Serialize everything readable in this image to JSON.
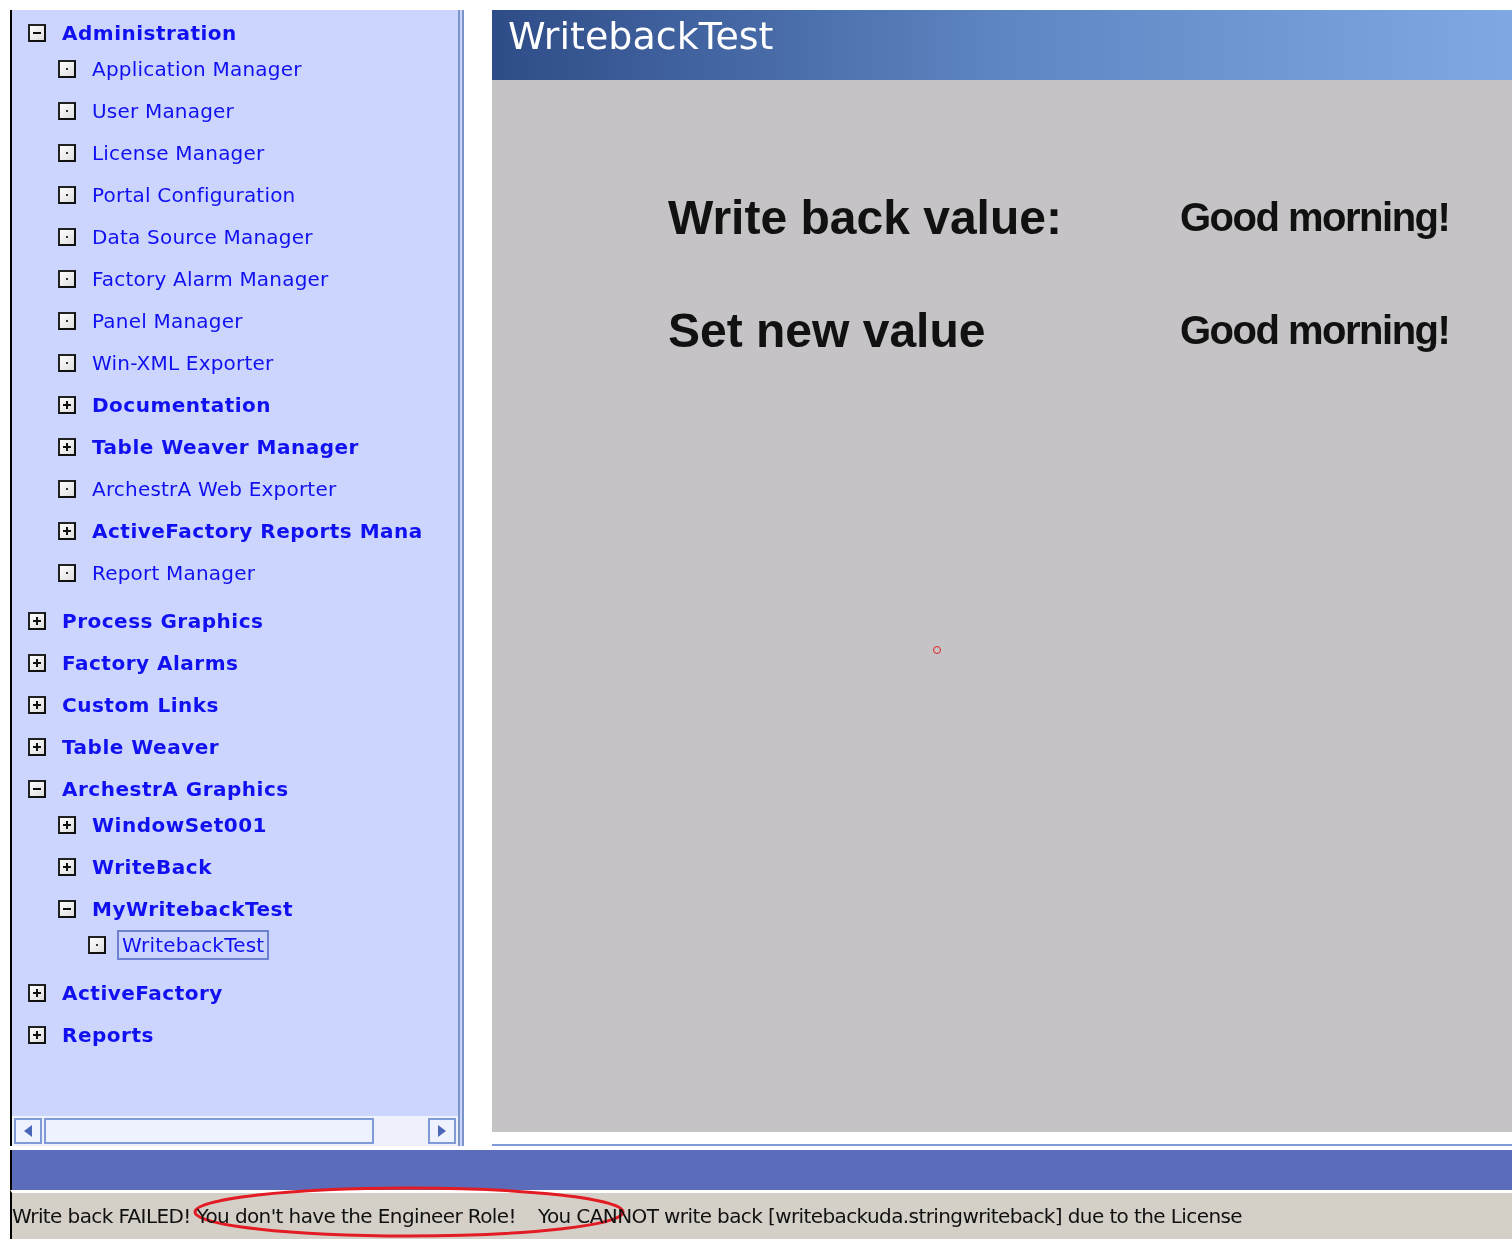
{
  "window": {
    "title": "WritebackTest"
  },
  "sidebar": {
    "tree": [
      {
        "label": "Administration",
        "kind": "folder",
        "expanded": true,
        "selected": false,
        "children": [
          {
            "label": "Application Manager",
            "kind": "leaf",
            "selected": false
          },
          {
            "label": "User Manager",
            "kind": "leaf",
            "selected": false
          },
          {
            "label": "License Manager",
            "kind": "leaf",
            "selected": false
          },
          {
            "label": "Portal Configuration",
            "kind": "leaf",
            "selected": false
          },
          {
            "label": "Data Source Manager",
            "kind": "leaf",
            "selected": false
          },
          {
            "label": "Factory Alarm Manager",
            "kind": "leaf",
            "selected": false
          },
          {
            "label": "Panel Manager",
            "kind": "leaf",
            "selected": false
          },
          {
            "label": "Win-XML Exporter",
            "kind": "leaf",
            "selected": false
          },
          {
            "label": "Documentation",
            "kind": "folder",
            "expanded": false,
            "selected": false
          },
          {
            "label": "Table Weaver Manager",
            "kind": "folder",
            "expanded": false,
            "selected": false
          },
          {
            "label": "ArchestrA Web Exporter",
            "kind": "leaf",
            "selected": false
          },
          {
            "label": "ActiveFactory Reports Mana",
            "kind": "folder",
            "expanded": false,
            "selected": false
          },
          {
            "label": "Report Manager",
            "kind": "leaf",
            "selected": false
          }
        ]
      },
      {
        "label": "Process Graphics",
        "kind": "folder",
        "expanded": false,
        "selected": false
      },
      {
        "label": "Factory Alarms",
        "kind": "folder",
        "expanded": false,
        "selected": false
      },
      {
        "label": "Custom Links",
        "kind": "folder",
        "expanded": false,
        "selected": false
      },
      {
        "label": "Table Weaver",
        "kind": "folder",
        "expanded": false,
        "selected": false
      },
      {
        "label": "ArchestrA Graphics",
        "kind": "folder",
        "expanded": true,
        "selected": false,
        "children": [
          {
            "label": "WindowSet001",
            "kind": "folder",
            "expanded": false,
            "selected": false
          },
          {
            "label": "WriteBack",
            "kind": "folder",
            "expanded": false,
            "selected": false
          },
          {
            "label": "MyWritebackTest",
            "kind": "folder",
            "expanded": true,
            "selected": false,
            "children": [
              {
                "label": "WritebackTest",
                "kind": "leaf",
                "selected": true
              }
            ]
          }
        ]
      },
      {
        "label": "ActiveFactory",
        "kind": "folder",
        "expanded": false,
        "selected": false
      },
      {
        "label": "Reports",
        "kind": "folder",
        "expanded": false,
        "selected": false
      }
    ]
  },
  "content": {
    "rows": [
      {
        "label": "Write back value:",
        "value": "Good morning!"
      },
      {
        "label": "Set new value",
        "value": "Good morning!"
      }
    ]
  },
  "status_bar": {
    "messages": [
      "Write back FAILED! You don't have the Engineer Role!",
      "You CANNOT write back [writebackuda.stringwriteback] due to the License"
    ]
  }
}
